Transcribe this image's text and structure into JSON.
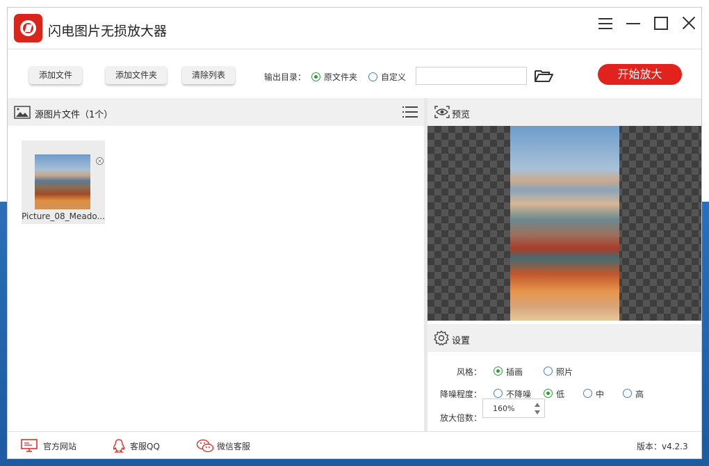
{
  "app": {
    "title": "闪电图片无损放大器"
  },
  "toolbar": {
    "add_file": "添加文件",
    "add_folder": "添加文件夹",
    "clear_list": "清除列表",
    "output_label": "输出目录：",
    "option_original": "原文件夹",
    "option_custom": "自定义",
    "path_value": "",
    "start_label": "开始放大"
  },
  "source": {
    "title": "源图片文件（1个）",
    "files": [
      {
        "name": "Picture_08_Meado..."
      }
    ]
  },
  "preview": {
    "title": "预览"
  },
  "settings": {
    "title": "设置",
    "style_label": "风格：",
    "style_options": [
      "插画",
      "照片"
    ],
    "noise_label": "降噪程度：",
    "noise_options": [
      "不降噪",
      "低",
      "中",
      "高"
    ],
    "scale_label": "放大倍数：",
    "scale_value": "160%"
  },
  "footer": {
    "website": "官方网站",
    "qq": "客服QQ",
    "wechat": "微信客服",
    "version": "版本：v4.2.3"
  },
  "colors": {
    "accent": "#e2221c",
    "radio_selected": "#2f9a39"
  }
}
